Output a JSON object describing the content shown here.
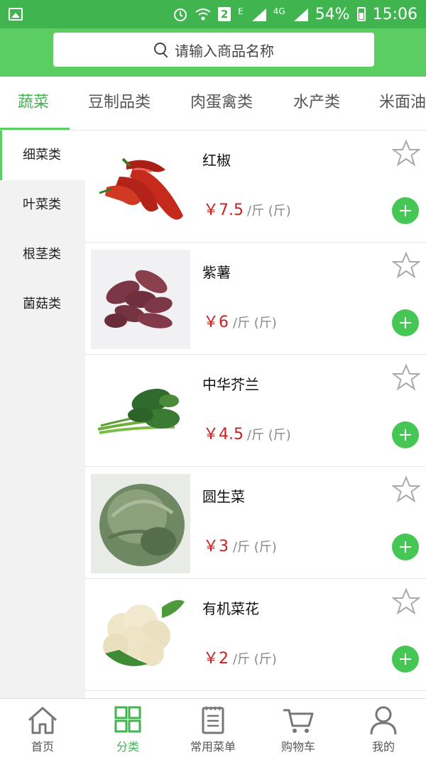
{
  "status_bar": {
    "battery": "54%",
    "time": "15:06",
    "sim_slot": "2",
    "network_e": "E",
    "network_4g": "4G"
  },
  "search": {
    "placeholder": "请输入商品名称"
  },
  "category_tabs": [
    "蔬菜",
    "豆制品类",
    "肉蛋禽类",
    "水产类",
    "米面油"
  ],
  "active_tab": "蔬菜",
  "side_menu": [
    "细菜类",
    "叶菜类",
    "根茎类",
    "菌菇类"
  ],
  "active_side": "细菜类",
  "products": [
    {
      "name": "红椒",
      "price": "￥7.5",
      "unit": "/斤 (斤)",
      "image": "red-pepper"
    },
    {
      "name": "紫薯",
      "price": "￥6",
      "unit": "/斤 (斤)",
      "image": "purple-sweet-potato"
    },
    {
      "name": "中华芥兰",
      "price": "￥4.5",
      "unit": "/斤 (斤)",
      "image": "chinese-kale"
    },
    {
      "name": "圆生菜",
      "price": "￥3",
      "unit": "/斤 (斤)",
      "image": "iceberg-lettuce"
    },
    {
      "name": "有机菜花",
      "price": "￥2",
      "unit": "/斤 (斤)",
      "image": "cauliflower"
    }
  ],
  "bottom_nav": [
    {
      "label": "首页",
      "icon": "home-icon"
    },
    {
      "label": "分类",
      "icon": "grid-icon"
    },
    {
      "label": "常用菜单",
      "icon": "list-icon"
    },
    {
      "label": "购物车",
      "icon": "cart-icon"
    },
    {
      "label": "我的",
      "icon": "user-icon"
    }
  ],
  "active_nav": "分类",
  "colors": {
    "brand_green": "#5ccd62",
    "status_green": "#3fb44f",
    "price_red": "#cc1f1f"
  }
}
